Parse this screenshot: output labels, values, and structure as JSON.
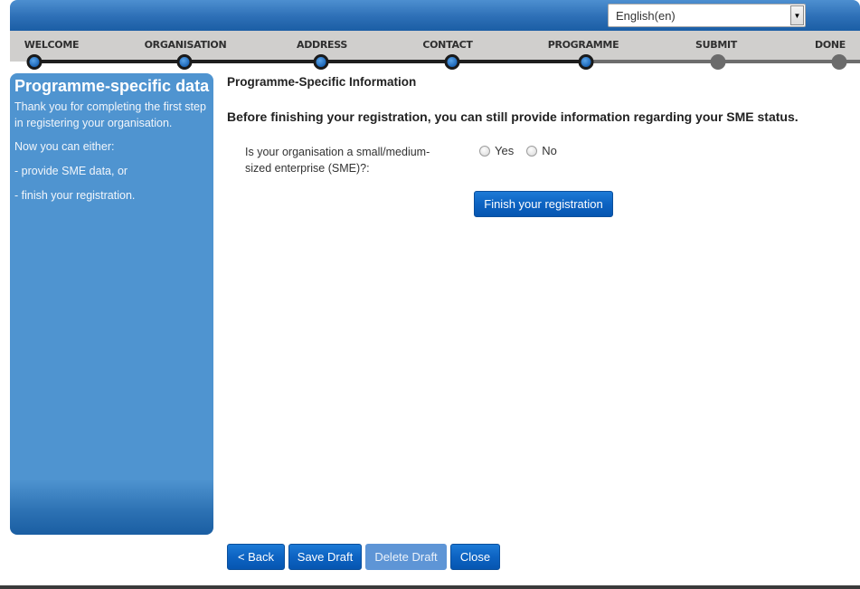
{
  "header": {
    "language_select": {
      "value": "English(en)",
      "arrow_icon": "chevron-down-icon"
    }
  },
  "steps": [
    {
      "label": "WELCOME",
      "status": "completed"
    },
    {
      "label": "ORGANISATION",
      "status": "completed"
    },
    {
      "label": "ADDRESS",
      "status": "completed"
    },
    {
      "label": "CONTACT",
      "status": "completed"
    },
    {
      "label": "PROGRAMME",
      "status": "current"
    },
    {
      "label": "SUBMIT",
      "status": "pending"
    },
    {
      "label": "DONE",
      "status": "pending"
    }
  ],
  "sidebar": {
    "title": "Programme-specific data",
    "paragraphs": [
      "Thank you for completing the first step in registering your organisation.",
      "Now you can either:",
      "- provide SME data, or",
      "- finish your registration."
    ]
  },
  "main": {
    "section_title": "Programme-Specific Information",
    "intro": "Before finishing your registration, you can still provide information regarding your SME status.",
    "question": "Is your organisation a small/medium-sized enterprise (SME)?:",
    "options": [
      {
        "label": "Yes",
        "checked": false
      },
      {
        "label": "No",
        "checked": false
      }
    ],
    "finish_button": "Finish your registration"
  },
  "footer": {
    "back_button": "< Back",
    "save_draft_button": "Save Draft",
    "delete_draft_button": "Delete Draft",
    "close_button": "Close"
  },
  "colors": {
    "brand_blue": "#1b5ea5",
    "sidebar_blue": "#4f94d0",
    "button_blue": "#0d63c2",
    "disabled_button": "#5e95d6",
    "step_completed": "#1d67b8",
    "step_pending": "#6b6b6b"
  }
}
